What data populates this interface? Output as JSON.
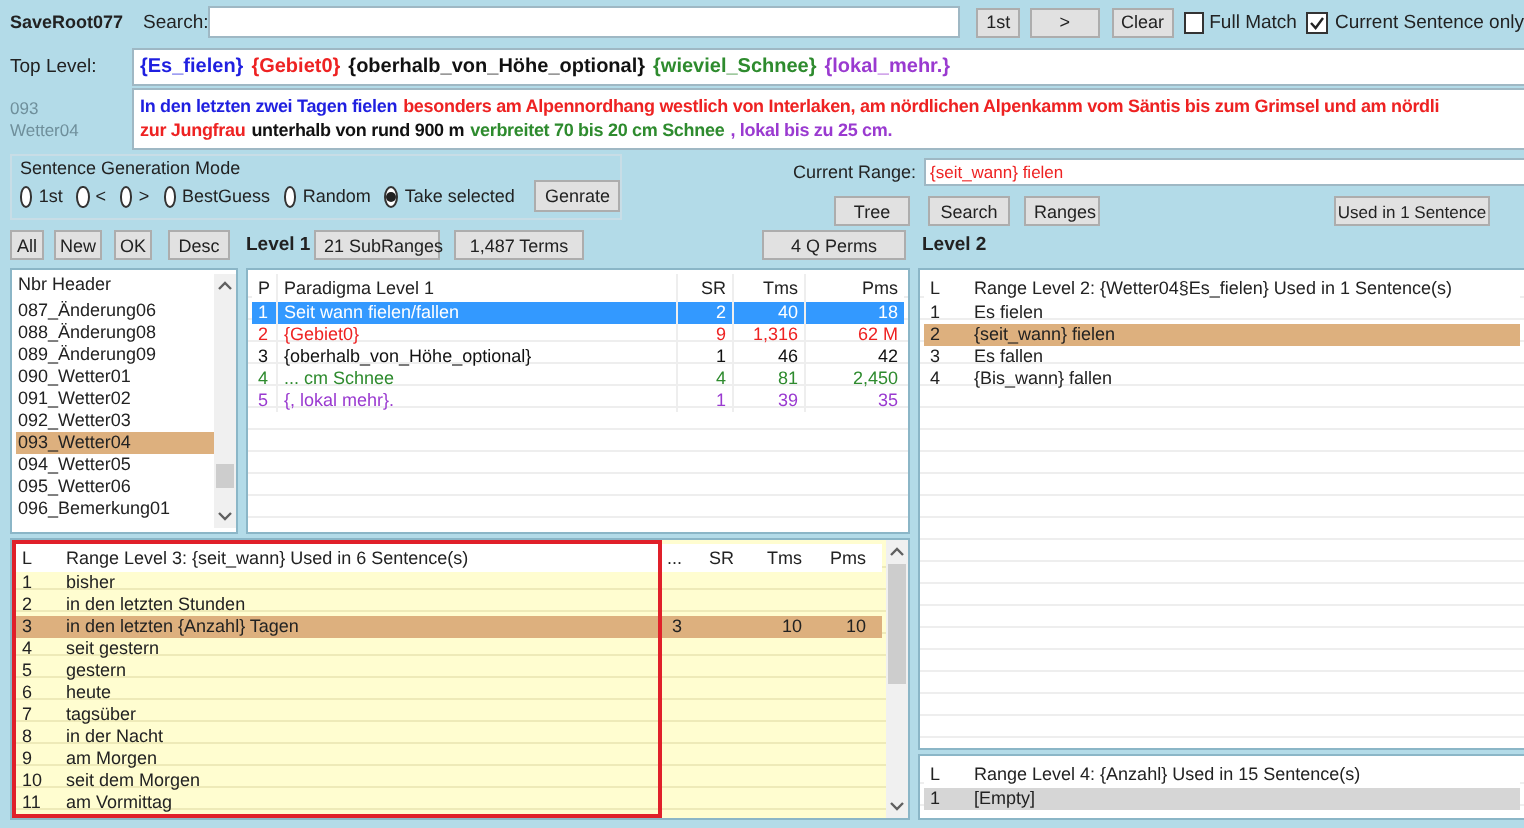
{
  "window": {
    "title": "SaveRoot077"
  },
  "search": {
    "label": "Search:",
    "buttons": [
      "1st",
      ">",
      "Clear"
    ],
    "options": [
      {
        "label": "Full Match",
        "checked": false
      },
      {
        "label": "Current Sentence only",
        "checked": true
      }
    ]
  },
  "top_level": {
    "label": "Top Level:",
    "tokens": [
      {
        "text": "{Es_fielen}",
        "color": "#1f1fe0"
      },
      {
        "text": "{Gebiet0}",
        "color": "#ee2222"
      },
      {
        "text": "{oberhalb_von_Höhe_optional}",
        "color": "#111111"
      },
      {
        "text": "{wieviel_Schnee}",
        "color": "#2e8b2e"
      },
      {
        "text": "{lokal_mehr.}",
        "color": "#9a3ad0"
      }
    ]
  },
  "sentence": {
    "header": [
      "093",
      "Wetter04"
    ],
    "lines": [
      [
        {
          "text": "In den letzten zwei Tagen fielen",
          "color": "#1f1fe0"
        },
        {
          "text": "besonders am Alpennordhang westlich von Interlaken, am nördlichen Alpenkamm vom Säntis bis zum Grimsel und am nördli",
          "color": "#ee2222"
        }
      ],
      [
        {
          "text": "zur Jungfrau",
          "color": "#ee2222"
        },
        {
          "text": "unterhalb von rund 900 m",
          "color": "#111111"
        },
        {
          "text": "verbreitet 70 bis 20 cm Schnee",
          "color": "#2e8b2e"
        },
        {
          "text": ", lokal bis zu 25 cm.",
          "color": "#9a3ad0"
        }
      ]
    ]
  },
  "generation_mode": {
    "title": "Sentence Generation Mode",
    "options": [
      {
        "label": "1st",
        "selected": false
      },
      {
        "label": "<",
        "selected": false
      },
      {
        "label": ">",
        "selected": false
      },
      {
        "label": "BestGuess",
        "selected": false
      },
      {
        "label": "Random",
        "selected": false
      },
      {
        "label": "Take selected",
        "selected": true
      }
    ],
    "button": "Genrate"
  },
  "current_range": {
    "label": "Current Range:",
    "value": "{seit_wann} fielen",
    "buttons": [
      "Tree",
      "Search",
      "Ranges"
    ],
    "used_button": "Used in 1 Sentence"
  },
  "toolbar": {
    "buttons": [
      "All",
      "New",
      "OK",
      "Desc"
    ],
    "level1_label": "Level 1",
    "counts": [
      "21 SubRanges",
      "1,487 Terms"
    ],
    "perms": "4 Q Perms",
    "level2_label": "Level 2"
  },
  "header_list": {
    "title": "Nbr Header",
    "items": [
      {
        "label": "087_Änderung06",
        "selected": false
      },
      {
        "label": "088_Änderung08",
        "selected": false
      },
      {
        "label": "089_Änderung09",
        "selected": false
      },
      {
        "label": "090_Wetter01",
        "selected": false
      },
      {
        "label": "091_Wetter02",
        "selected": false
      },
      {
        "label": "092_Wetter03",
        "selected": false
      },
      {
        "label": "093_Wetter04",
        "selected": true
      },
      {
        "label": "094_Wetter05",
        "selected": false
      },
      {
        "label": "095_Wetter06",
        "selected": false
      },
      {
        "label": "096_Bemerkung01",
        "selected": false
      }
    ]
  },
  "paradigma": {
    "columns": [
      "P",
      "Paradigma Level 1",
      "SR",
      "Tms",
      "Pms"
    ],
    "rows": [
      {
        "cells": [
          "1",
          "Seit wann fielen/fallen",
          "2",
          "40",
          "18"
        ],
        "selected": true
      },
      {
        "cells": [
          "2",
          "{Gebiet0}",
          "9",
          "1,316",
          "62 M"
        ],
        "color": "#ee2222",
        "selected": false
      },
      {
        "cells": [
          "3",
          "{oberhalb_von_Höhe_optional}",
          "1",
          "46",
          "42"
        ],
        "color": "#111111",
        "selected": false
      },
      {
        "cells": [
          "4",
          "... cm Schnee",
          "4",
          "81",
          "2,450"
        ],
        "color": "#2e8b2e",
        "selected": false
      },
      {
        "cells": [
          "5",
          "{, lokal mehr}.",
          "1",
          "39",
          "35"
        ],
        "color": "#9a3ad0",
        "selected": false
      }
    ]
  },
  "level2": {
    "columns": [
      "L",
      "Range Level 2: {Wetter04§Es_fielen} Used in 1 Sentence(s)"
    ],
    "rows": [
      {
        "cells": [
          "1",
          "Es fielen"
        ],
        "selected": false
      },
      {
        "cells": [
          "2",
          "{seit_wann} fielen"
        ],
        "selected": true
      },
      {
        "cells": [
          "3",
          "Es fallen"
        ],
        "selected": false
      },
      {
        "cells": [
          "4",
          "{Bis_wann} fallen"
        ],
        "selected": false
      }
    ]
  },
  "level3": {
    "highlighted": true,
    "columns": [
      "L",
      "Range Level 3: {seit_wann} Used in 6 Sentence(s)",
      "...",
      "SR",
      "Tms",
      "Pms"
    ],
    "rows": [
      {
        "cells": [
          "1",
          "bisher"
        ],
        "selected": false
      },
      {
        "cells": [
          "2",
          "in den letzten Stunden"
        ],
        "selected": false
      },
      {
        "cells": [
          "3",
          "in den letzten {Anzahl} Tagen",
          "3",
          null,
          "10",
          "10"
        ],
        "selected": true
      },
      {
        "cells": [
          "4",
          "seit gestern"
        ],
        "selected": false
      },
      {
        "cells": [
          "5",
          "gestern"
        ],
        "selected": false
      },
      {
        "cells": [
          "6",
          "heute"
        ],
        "selected": false
      },
      {
        "cells": [
          "7",
          "tagsüber"
        ],
        "selected": false
      },
      {
        "cells": [
          "8",
          "in der Nacht"
        ],
        "selected": false
      },
      {
        "cells": [
          "9",
          "am Morgen"
        ],
        "selected": false
      },
      {
        "cells": [
          "10",
          "seit dem Morgen"
        ],
        "selected": false
      },
      {
        "cells": [
          "11",
          "am Vormittag"
        ],
        "selected": false
      }
    ]
  },
  "level4": {
    "columns": [
      "L",
      "Range Level 4: {Anzahl} Used in 15 Sentence(s)"
    ],
    "rows": [
      {
        "cells": [
          "1",
          "[Empty]"
        ],
        "selected": true
      }
    ]
  }
}
